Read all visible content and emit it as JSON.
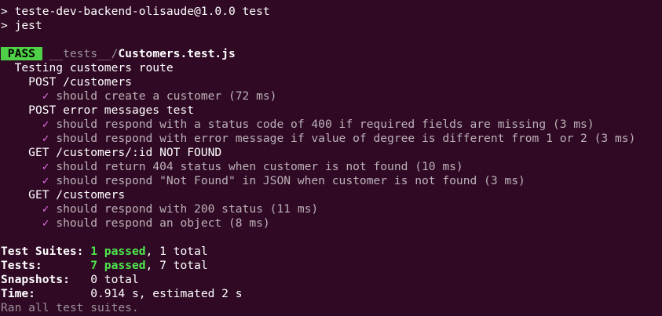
{
  "colors": {
    "background": "#300a24",
    "pass_badge": "#4ed146",
    "check": "#e76ee7",
    "passed_count": "#4ee84d"
  },
  "header": {
    "line1": "> teste-dev-backend-olisaude@1.0.0 test",
    "line2": "> jest"
  },
  "file_result": {
    "status": " PASS ",
    "path_dir": "__tests__/",
    "path_file": "Customers.test.js"
  },
  "suite": {
    "title": "Testing customers route",
    "groups": [
      {
        "title": "POST /customers",
        "tests": [
          {
            "check": "✓",
            "text": "should create a customer (72 ms)"
          }
        ]
      },
      {
        "title": "POST error messages test",
        "tests": [
          {
            "check": "✓",
            "text": "should respond with a status code of 400 if required fields are missing (3 ms)"
          },
          {
            "check": "✓",
            "text": "should respond with error message if value of degree is different from 1 or 2 (3 ms)"
          }
        ]
      },
      {
        "title": "GET /customers/:id NOT FOUND",
        "tests": [
          {
            "check": "✓",
            "text": "should return 404 status when customer is not found (10 ms)"
          },
          {
            "check": "✓",
            "text": "should respond \"Not Found\" in JSON when customer is not found (3 ms)"
          }
        ]
      },
      {
        "title": "GET /customers",
        "tests": [
          {
            "check": "✓",
            "text": "should respond with 200 status (11 ms)"
          },
          {
            "check": "✓",
            "text": "should respond an object (8 ms)"
          }
        ]
      }
    ]
  },
  "summary": {
    "suites_label": "Test Suites:",
    "suites_passed": "1 passed",
    "suites_total": ", 1 total",
    "tests_label": "Tests:",
    "tests_passed": "7 passed",
    "tests_total": ", 7 total",
    "snapshots_label": "Snapshots:",
    "snapshots_value": "0 total",
    "time_label": "Time:",
    "time_value": "0.914 s, estimated 2 s",
    "footer": "Ran all test suites."
  }
}
